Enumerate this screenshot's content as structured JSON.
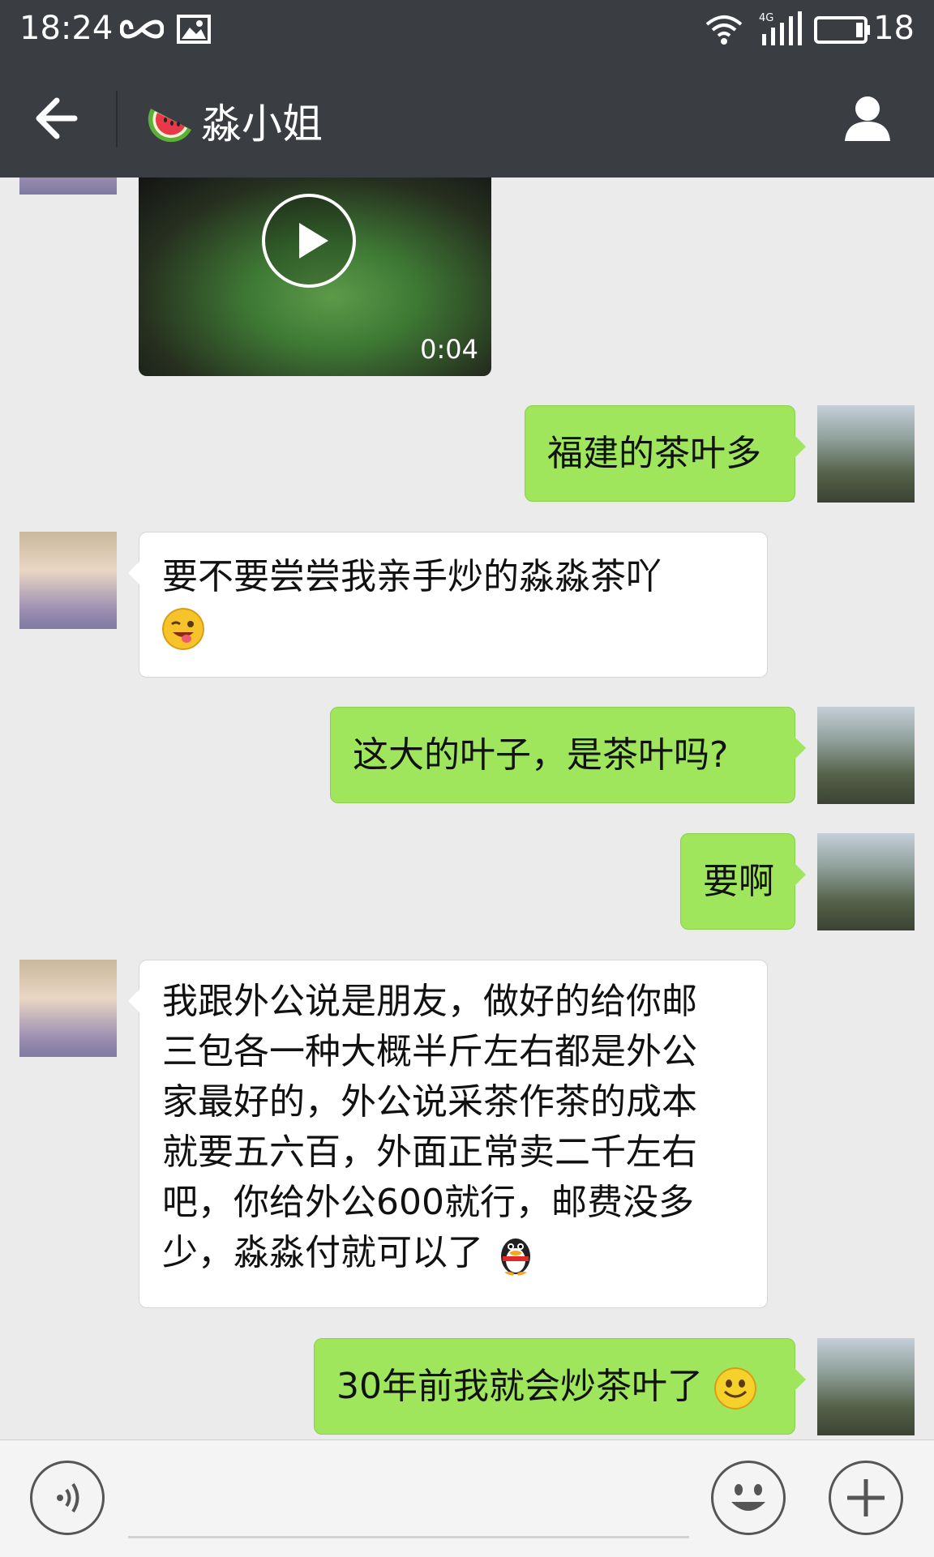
{
  "status_bar": {
    "time": "18:24",
    "network": "4G",
    "battery": "18",
    "icons": [
      "infinity-icon",
      "image-icon",
      "wifi-icon",
      "signal-icon",
      "battery-icon"
    ]
  },
  "header": {
    "title": "淼小姐",
    "title_emoji": "watermelon-icon",
    "back_icon": "back-arrow-icon",
    "profile_icon": "person-icon"
  },
  "colors": {
    "header_bg": "#3a3d42",
    "chat_bg": "#ebebeb",
    "outgoing_bubble": "#9fe65d",
    "incoming_bubble": "#ffffff"
  },
  "messages": [
    {
      "side": "in",
      "type": "video",
      "duration": "0:04"
    },
    {
      "side": "out",
      "text": "福建的茶叶多"
    },
    {
      "side": "in",
      "text": "要不要尝尝我亲手炒的淼淼茶吖",
      "emoji": "wink-tongue-emoji"
    },
    {
      "side": "out",
      "text": "这大的叶子，是茶叶吗?"
    },
    {
      "side": "out",
      "text": "要啊"
    },
    {
      "side": "in",
      "lines": [
        "我跟外公说是朋友，做好的给你邮",
        "三包各一种大概半斤左右都是外公",
        "家最好的，外公说采茶作茶的成本",
        "就要五六百，外面正常卖二千左右",
        "吧，你给外公600就行，邮费没多",
        "少，淼淼付就可以了"
      ],
      "emoji": "penguin-emoji"
    },
    {
      "side": "out",
      "text": "30年前我就会炒茶叶了",
      "emoji": "smile-emoji"
    }
  ],
  "input_bar": {
    "voice_icon": "voice-icon",
    "emoji_icon": "emoji-icon",
    "plus_icon": "plus-icon"
  }
}
